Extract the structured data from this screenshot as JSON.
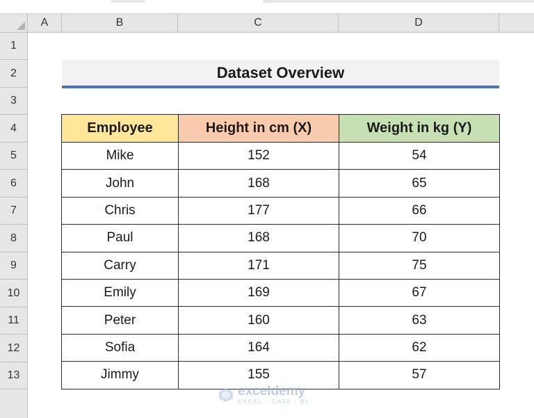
{
  "columns": [
    "A",
    "B",
    "C",
    "D"
  ],
  "rows": [
    "1",
    "2",
    "3",
    "4",
    "5",
    "6",
    "7",
    "8",
    "9",
    "10",
    "11",
    "12",
    "13"
  ],
  "title": "Dataset Overview",
  "table": {
    "headers": [
      "Employee",
      "Height in cm (X)",
      "Weight in kg (Y)"
    ],
    "header_colors": [
      "#ffe699",
      "#f8cbad",
      "#c6e0b4"
    ],
    "rows": [
      [
        "Mike",
        "152",
        "54"
      ],
      [
        "John",
        "168",
        "65"
      ],
      [
        "Chris",
        "177",
        "66"
      ],
      [
        "Paul",
        "168",
        "70"
      ],
      [
        "Carry",
        "171",
        "75"
      ],
      [
        "Emily",
        "169",
        "67"
      ],
      [
        "Peter",
        "160",
        "63"
      ],
      [
        "Sofia",
        "164",
        "62"
      ],
      [
        "Jimmy",
        "155",
        "57"
      ]
    ]
  },
  "watermark": {
    "name": "exceldemy",
    "tagline": "EXCEL · DATA · BI"
  },
  "colors": {
    "title_underline": "#4472c4",
    "grid_header": "#e6e6e6"
  }
}
